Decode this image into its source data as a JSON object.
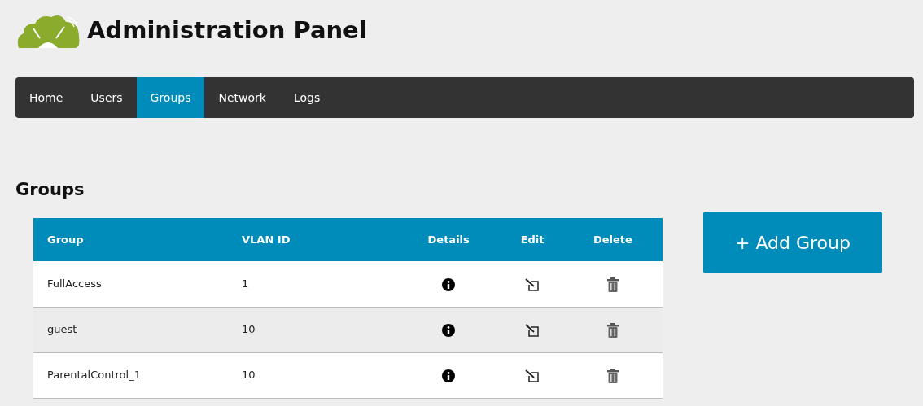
{
  "header": {
    "title": "Administration Panel"
  },
  "nav": [
    {
      "label": "Home",
      "selected": false
    },
    {
      "label": "Users",
      "selected": false
    },
    {
      "label": "Groups",
      "selected": true
    },
    {
      "label": "Network",
      "selected": false
    },
    {
      "label": "Logs",
      "selected": false
    }
  ],
  "section_title": "Groups",
  "table": {
    "columns": [
      "Group",
      "VLAN ID",
      "Details",
      "Edit",
      "Delete"
    ],
    "rows": [
      {
        "group": "FullAccess",
        "vlan_id": "1"
      },
      {
        "group": "guest",
        "vlan_id": "10"
      },
      {
        "group": "ParentalControl_1",
        "vlan_id": "10"
      }
    ]
  },
  "add_button": "+ Add Group"
}
